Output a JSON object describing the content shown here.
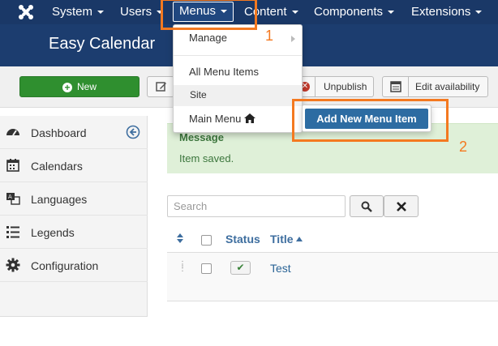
{
  "topnav": {
    "items": [
      {
        "label": "System"
      },
      {
        "label": "Users"
      },
      {
        "label": "Menus"
      },
      {
        "label": "Content"
      },
      {
        "label": "Components"
      },
      {
        "label": "Extensions"
      }
    ]
  },
  "header": {
    "title": "Easy Calendar"
  },
  "toolbar": {
    "new_label": "New",
    "unpublish_label": "Unpublish",
    "edit_availability_label": "Edit availability"
  },
  "sidebar": {
    "items": [
      {
        "label": "Dashboard",
        "icon": "dashboard-icon"
      },
      {
        "label": "Calendars",
        "icon": "calendar-icon"
      },
      {
        "label": "Languages",
        "icon": "language-icon"
      },
      {
        "label": "Legends",
        "icon": "list-icon"
      },
      {
        "label": "Configuration",
        "icon": "gear-icon"
      }
    ]
  },
  "message": {
    "title": "Message",
    "text": "Item saved."
  },
  "search": {
    "placeholder": "Search"
  },
  "table": {
    "headers": {
      "status": "Status",
      "title": "Title"
    },
    "rows": [
      {
        "title": "Test",
        "status": "published"
      }
    ]
  },
  "menus_dropdown": {
    "manage": "Manage",
    "all_menu_items": "All Menu Items",
    "site_header": "Site",
    "main_menu": "Main Menu"
  },
  "submenu": {
    "add_new_menu_item": "Add New Menu Item"
  },
  "annotations": {
    "callout_1": "1",
    "callout_2": "2"
  },
  "colors": {
    "nav_bg": "#1a3867",
    "title_bg": "#1c3d6f",
    "new_button": "#2f8f2f",
    "submenu_highlight": "#2d6ca2",
    "annotation": "#f47920",
    "message_bg": "#dff0d8"
  }
}
